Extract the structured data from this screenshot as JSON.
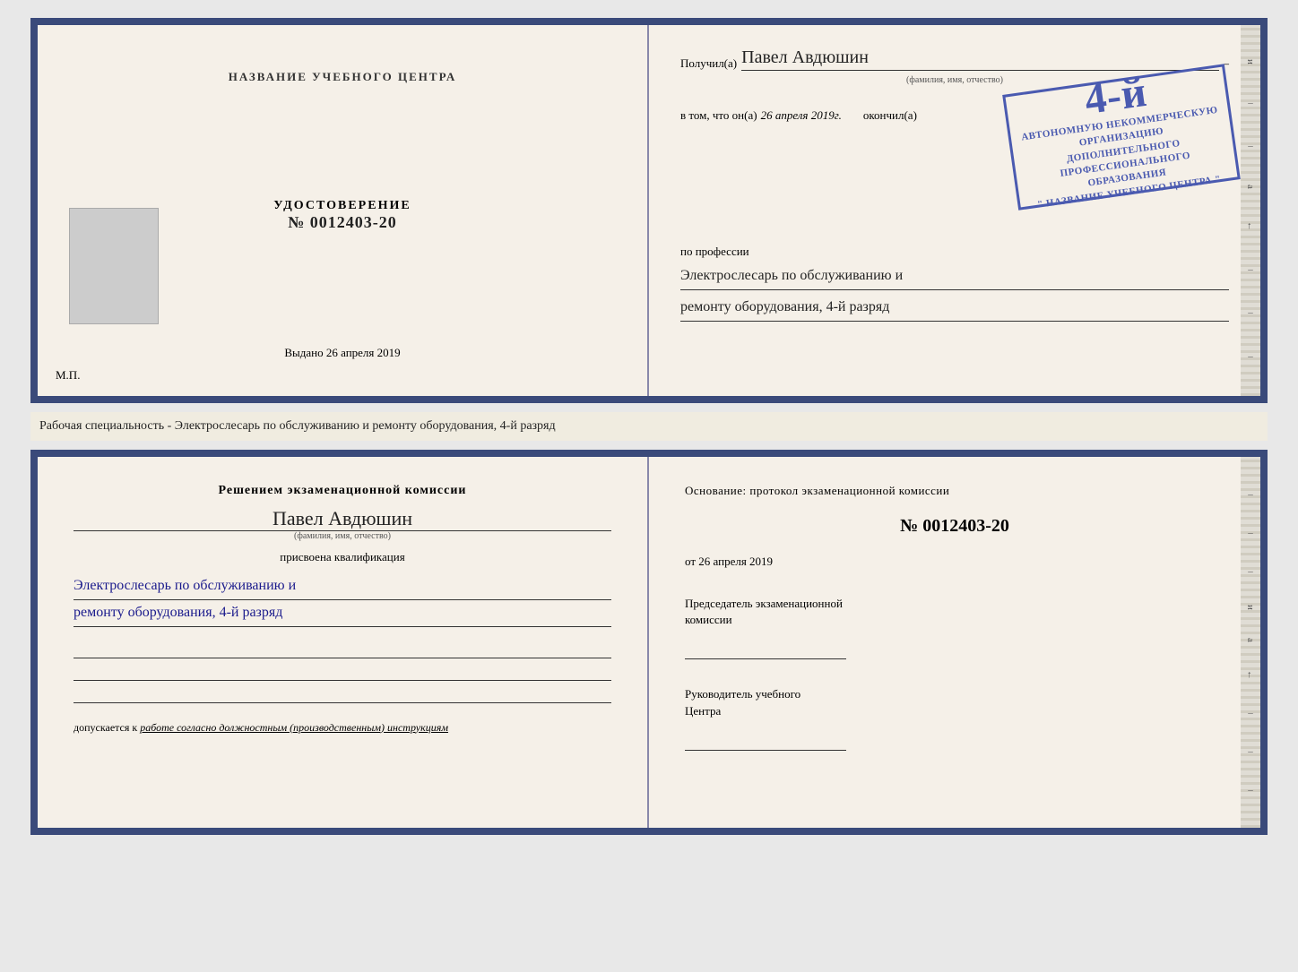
{
  "top_left": {
    "title": "НАЗВАНИЕ УЧЕБНОГО ЦЕНТРА",
    "cert_label": "УДОСТОВЕРЕНИЕ",
    "cert_number": "№ 0012403-20",
    "issued_prefix": "Выдано",
    "issued_date": "26 апреля 2019",
    "mp_label": "М.П."
  },
  "top_right": {
    "recipient_prefix": "Получил(а)",
    "recipient_name": "Павел Авдюшин",
    "recipient_subtitle": "(фамилия, имя, отчество)",
    "in_that_prefix": "в том, что он(а)",
    "completion_date": "26 апреля 2019г.",
    "completed_label": "окончил(а)",
    "stamp_line1": "АВТОНОМНУЮ НЕКОММЕРЧЕСКУЮ ОРГАНИЗАЦИЮ",
    "stamp_line2": "ДОПОЛНИТЕЛЬНОГО ПРОФЕССИОНАЛЬНОГО ОБРАЗОВАНИЯ",
    "stamp_line3": "\" НАЗВАНИЕ УЧЕБНОГО ЦЕНТРА \"",
    "grade_number": "4-й",
    "profession_prefix": "по профессии",
    "profession_value1": "Электрослесарь по обслуживанию и",
    "profession_value2": "ремонту оборудования, 4-й разряд"
  },
  "middle_text": "Рабочая специальность - Электрослесарь по обслуживанию и ремонту оборудования, 4-й разряд",
  "bottom_left": {
    "commission_title": "Решением экзаменационной комиссии",
    "person_name": "Павел Авдюшин",
    "person_subtitle": "(фамилия, имя, отчество)",
    "qualification_prefix": "присвоена квалификация",
    "qualification_value1": "Электрослесарь по обслуживанию и",
    "qualification_value2": "ремонту оборудования, 4-й разряд",
    "allowed_prefix": "допускается к",
    "allowed_value": "работе согласно должностным (производственным) инструкциям"
  },
  "bottom_right": {
    "basis_text": "Основание: протокол экзаменационной комиссии",
    "protocol_number": "№ 0012403-20",
    "date_prefix": "от",
    "date_value": "26 апреля 2019",
    "chairman_label1": "Председатель экзаменационной",
    "chairman_label2": "комиссии",
    "director_label1": "Руководитель учебного",
    "director_label2": "Центра"
  },
  "edge_marks": {
    "top_mark1": "и",
    "top_mark2": "а",
    "top_mark3": "←"
  }
}
